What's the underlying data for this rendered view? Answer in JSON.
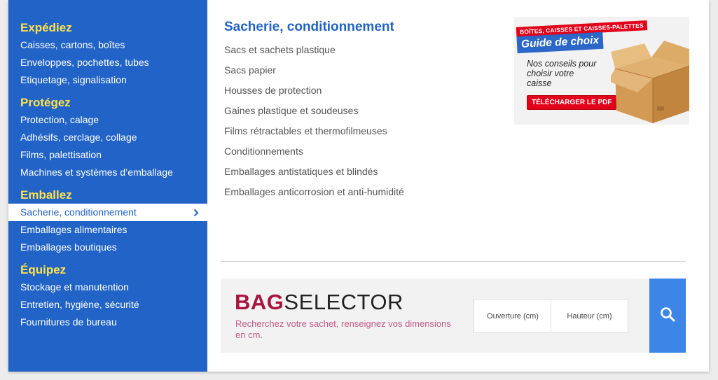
{
  "sidebar": {
    "groups": [
      {
        "title": "Expédiez",
        "items": [
          "Caisses, cartons, boîtes",
          "Enveloppes, pochettes, tubes",
          "Etiquetage, signalisation"
        ]
      },
      {
        "title": "Protégez",
        "items": [
          "Protection, calage",
          "Adhésifs, cerclage, collage",
          "Films, palettisation",
          "Machines et systèmes d’emballage"
        ]
      },
      {
        "title": "Emballez",
        "items": [
          "Sacherie, conditionnement",
          "Emballages alimentaires",
          "Emballages boutiques"
        ]
      },
      {
        "title": "Équipez",
        "items": [
          "Stockage et manutention",
          "Entretien, hygiène, sécurité",
          "Fournitures de bureau"
        ]
      }
    ],
    "active_item": "Sacherie, conditionnement",
    "active_icon": "chevron-right-icon"
  },
  "main": {
    "title": "Sacherie, conditionnement",
    "links": [
      "Sacs et sachets plastique",
      "Sacs papier",
      "Housses de protection",
      "Gaines plastique et soudeuses",
      "Films rétractables et thermofilmeuses",
      "Conditionnements",
      "Emballages antistatiques et blindés",
      "Emballages anticorrosion et anti-humidité"
    ]
  },
  "promo": {
    "tag": "BOÎTES, CAISSES ET CAISSES-PALETTES",
    "headline": "Guide de choix",
    "text": "Nos conseils pour choisir votre caisse",
    "button": "TÉLÉCHARGER LE PDF",
    "image_icon": "cardboard-box-icon"
  },
  "bag_selector": {
    "logo_bag": "BAG",
    "logo_selector": "SELECTOR",
    "description": "Recherchez votre sachet, renseignez vos dimensions en cm.",
    "width_placeholder": "Ouverture (cm)",
    "height_placeholder": "Hauteur (cm)",
    "search_icon": "search-icon"
  },
  "colors": {
    "sidebar_bg": "#2163c6",
    "group_title": "#ffe14a",
    "accent": "#2163c6",
    "logo_bag": "#a9143f",
    "description": "#c25a86",
    "search_button": "#3d86e8",
    "promo_red": "#e2001a"
  }
}
